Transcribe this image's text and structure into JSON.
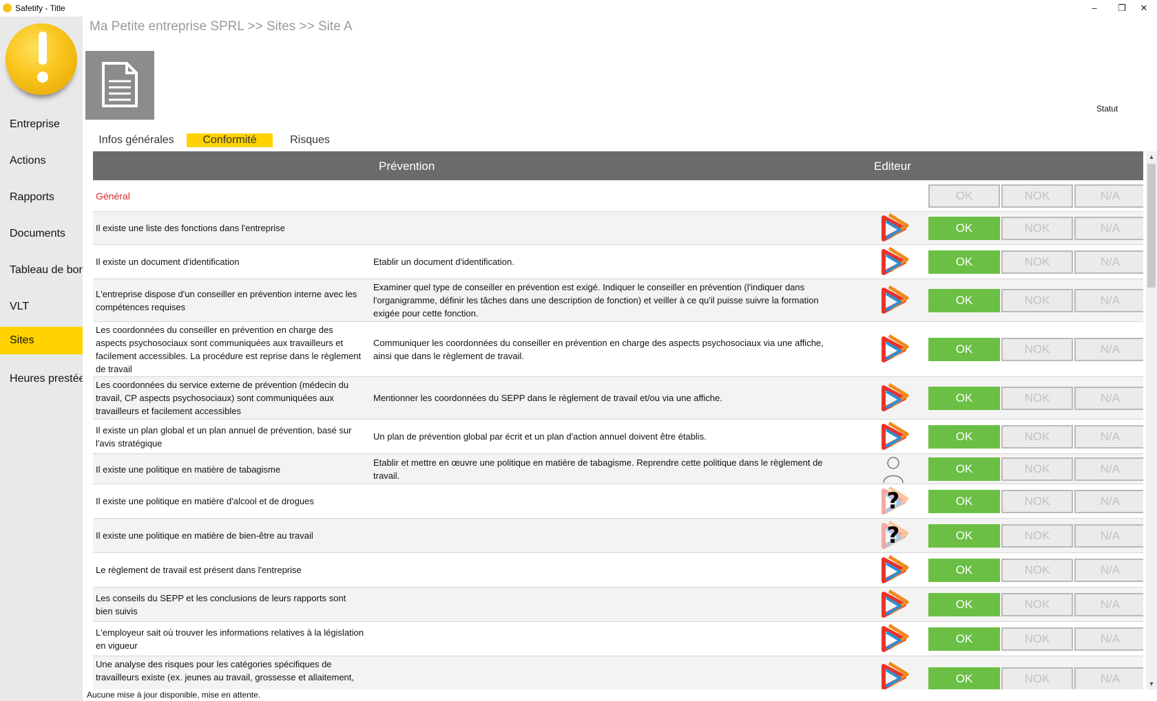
{
  "window": {
    "title": "Safetify - Title",
    "minimize": "–",
    "maximize": "❐",
    "close": "✕"
  },
  "sidebar": {
    "items": [
      {
        "label": "Entreprise",
        "active": false
      },
      {
        "label": "Actions",
        "active": false
      },
      {
        "label": "Rapports",
        "active": false
      },
      {
        "label": "Documents",
        "active": false
      },
      {
        "label": "Tableau de bord",
        "active": false
      },
      {
        "label": "VLT",
        "active": false
      },
      {
        "label": "Sites",
        "active": true
      },
      {
        "label": "Heures prestées",
        "active": false
      }
    ]
  },
  "header": {
    "breadcrumb": "Ma Petite entreprise SPRL >> Sites >> Site A",
    "statut_label": "Statut"
  },
  "tabs": [
    {
      "label": "Infos générales",
      "active": false
    },
    {
      "label": "Conformité",
      "active": true
    },
    {
      "label": "Risques",
      "active": false
    }
  ],
  "table": {
    "col_prevention": "Prévention",
    "col_editeur": "Editeur",
    "button_labels": {
      "ok": "OK",
      "nok": "NOK",
      "na": "N/A"
    },
    "section": "Général",
    "rows": [
      {
        "question": "Il existe une liste des fonctions dans l'entreprise",
        "action": "",
        "editor": "brand-logo-icon",
        "status": "OK"
      },
      {
        "question": "Il existe un document d'identification",
        "action": "Etablir un document d'identification.",
        "editor": "brand-logo-icon",
        "status": "OK"
      },
      {
        "question": "L'entreprise dispose d'un conseiller en prévention interne avec les compétences requises",
        "action": "Examiner quel type de conseiller en prévention est exigé.                   Indiquer le conseiller en prévention (l'indiquer dans l'organigramme, définir les tâches dans une description de fonction) et veiller à ce qu'il puisse suivre la formation exigée pour cette fonction.",
        "editor": "brand-logo-icon",
        "status": "OK"
      },
      {
        "question": "Les coordonnées du conseiller en prévention en charge des aspects psychosociaux sont communiquées aux travailleurs et facilement accessibles.  La procédure est reprise dans le règlement de travail",
        "action": "Communiquer les coordonnées du conseiller en prévention en charge des aspects psychosociaux via une affiche, ainsi que dans le règlement de travail.",
        "editor": "brand-logo-icon",
        "status": "OK"
      },
      {
        "question": "Les coordonnées du service externe de prévention (médecin du travail, CP aspects psychosociaux) sont communiquées aux travailleurs et facilement accessibles",
        "action": "Mentionner les coordonnées du SEPP dans le règlement de travail et/ou via une affiche.",
        "editor": "brand-logo-icon",
        "status": "OK"
      },
      {
        "question": "Il existe un plan global et un plan annuel de prévention, basé sur l'avis stratégique",
        "action": "Un plan de prévention global par écrit et un plan d'action annuel doivent être établis.",
        "editor": "brand-logo-icon",
        "status": "OK"
      },
      {
        "question": "Il existe une politique en matière de tabagisme",
        "action": "Etablir et mettre en œuvre une politique en matière de tabagisme. Reprendre cette politique dans le règlement de travail.",
        "editor": "user-icon",
        "status": "OK"
      },
      {
        "question": "Il existe une politique en matière d'alcool et de drogues",
        "action": "",
        "editor": "unknown-logo-icon",
        "status": "OK"
      },
      {
        "question": "Il existe une politique en matière de bien-être au travail",
        "action": "",
        "editor": "unknown-logo-icon",
        "status": "OK"
      },
      {
        "question": "Le règlement de travail est présent dans l'entreprise",
        "action": "",
        "editor": "brand-logo-icon",
        "status": "OK"
      },
      {
        "question": "Les conseils du SEPP et les conclusions de leurs rapports sont bien suivis",
        "action": "",
        "editor": "brand-logo-icon",
        "status": "OK"
      },
      {
        "question": "L'employeur sait où trouver les informations relatives à la législation en vigueur",
        "action": "",
        "editor": "brand-logo-icon",
        "status": "OK"
      },
      {
        "question": "Une analyse des risques pour les catégories spécifiques de travailleurs existe (ex. jeunes au travail, grossesse et allaitement,",
        "action": "",
        "editor": "brand-logo-icon",
        "status": "OK"
      }
    ]
  },
  "statusbar": {
    "text": "Aucune mise à jour disponible, mise en attente."
  },
  "colors": {
    "accent": "#ffd200",
    "ok": "#6bbf44",
    "section": "#d62b2b",
    "header": "#6b6b6b"
  }
}
